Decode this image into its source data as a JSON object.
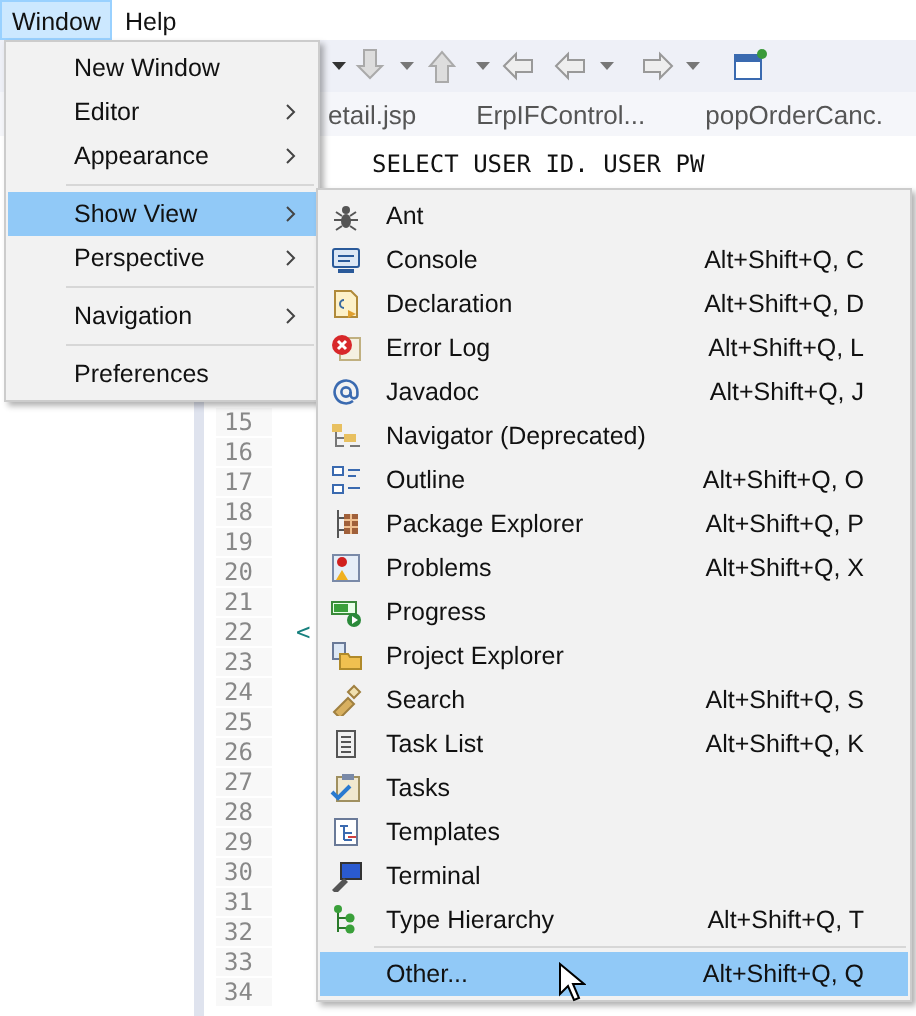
{
  "menubar": [
    {
      "label": "Window",
      "selected": true
    },
    {
      "label": "Help",
      "selected": false
    }
  ],
  "tabs": [
    {
      "label": "etail.jsp"
    },
    {
      "label": "ErpIFControl..."
    },
    {
      "label": "popOrderCanc."
    }
  ],
  "editor": {
    "code_line": "SELECT USER ID. USER PW",
    "lines": [
      {
        "number": "15"
      },
      {
        "number": "16"
      },
      {
        "number": "17"
      },
      {
        "number": "18"
      },
      {
        "number": "19"
      },
      {
        "number": "20"
      },
      {
        "number": "21"
      },
      {
        "number": "22",
        "code": "<"
      },
      {
        "number": "23"
      },
      {
        "number": "24"
      },
      {
        "number": "25"
      },
      {
        "number": "26"
      },
      {
        "number": "27"
      },
      {
        "number": "28"
      },
      {
        "number": "29"
      },
      {
        "number": "30"
      },
      {
        "number": "31"
      },
      {
        "number": "32"
      },
      {
        "number": "33"
      },
      {
        "number": "34"
      }
    ]
  },
  "window_menu": [
    {
      "kind": "item",
      "label": "New Window",
      "submenu": false,
      "selected": false
    },
    {
      "kind": "item",
      "label": "Editor",
      "submenu": true,
      "selected": false
    },
    {
      "kind": "item",
      "label": "Appearance",
      "submenu": true,
      "selected": false
    },
    {
      "kind": "separator"
    },
    {
      "kind": "item",
      "label": "Show View",
      "submenu": true,
      "selected": true
    },
    {
      "kind": "item",
      "label": "Perspective",
      "submenu": true,
      "selected": false
    },
    {
      "kind": "separator"
    },
    {
      "kind": "item",
      "label": "Navigation",
      "submenu": true,
      "selected": false
    },
    {
      "kind": "separator"
    },
    {
      "kind": "item",
      "label": "Preferences",
      "submenu": false,
      "selected": false
    }
  ],
  "show_view_menu": [
    {
      "kind": "item",
      "label": "Ant",
      "selected": false
    },
    {
      "kind": "item",
      "label": "Console",
      "shortcut": "Alt+Shift+Q, C",
      "selected": false
    },
    {
      "kind": "item",
      "label": "Declaration",
      "shortcut": "Alt+Shift+Q, D",
      "selected": false
    },
    {
      "kind": "item",
      "label": "Error Log",
      "shortcut": "Alt+Shift+Q, L",
      "selected": false
    },
    {
      "kind": "item",
      "label": "Javadoc",
      "shortcut": "Alt+Shift+Q, J",
      "selected": false
    },
    {
      "kind": "item",
      "label": "Navigator (Deprecated)",
      "selected": false
    },
    {
      "kind": "item",
      "label": "Outline",
      "shortcut": "Alt+Shift+Q, O",
      "selected": false
    },
    {
      "kind": "item",
      "label": "Package Explorer",
      "shortcut": "Alt+Shift+Q, P",
      "selected": false
    },
    {
      "kind": "item",
      "label": "Problems",
      "shortcut": "Alt+Shift+Q, X",
      "selected": false
    },
    {
      "kind": "item",
      "label": "Progress",
      "selected": false
    },
    {
      "kind": "item",
      "label": "Project Explorer",
      "selected": false
    },
    {
      "kind": "item",
      "label": "Search",
      "shortcut": "Alt+Shift+Q, S",
      "selected": false
    },
    {
      "kind": "item",
      "label": "Task List",
      "shortcut": "Alt+Shift+Q, K",
      "selected": false
    },
    {
      "kind": "item",
      "label": "Tasks",
      "selected": false
    },
    {
      "kind": "item",
      "label": "Templates",
      "selected": false
    },
    {
      "kind": "item",
      "label": "Terminal",
      "selected": false
    },
    {
      "kind": "item",
      "label": "Type Hierarchy",
      "shortcut": "Alt+Shift+Q, T",
      "selected": false
    },
    {
      "kind": "separator"
    },
    {
      "kind": "item",
      "label": "Other...",
      "shortcut": "Alt+Shift+Q, Q",
      "selected": true
    }
  ]
}
